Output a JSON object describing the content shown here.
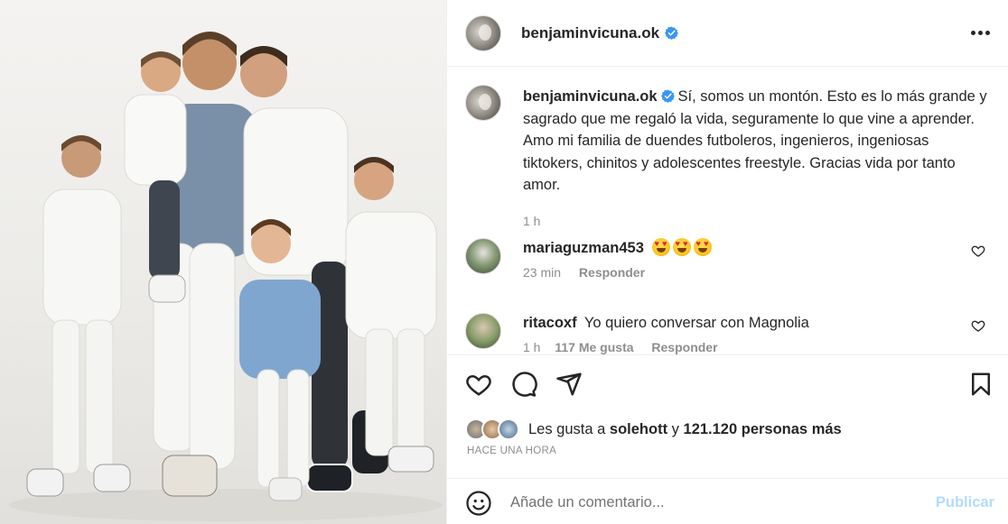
{
  "post": {
    "image_alt": "Foto familiar",
    "author": "benjaminvicuna.ok",
    "more_icon": "more-horizontal-icon"
  },
  "caption": {
    "username": "benjaminvicuna.ok",
    "text": "Sí, somos un montón. Esto es lo más grande y sagrado que me regaló la vida, seguramente lo que vine a aprender. Amo mi familia de duendes futboleros, ingenieros, ingeniosas tiktokers, chinitos y adolescentes freestyle. Gracias vida por tanto amor.",
    "time": "1 h"
  },
  "comments": [
    {
      "username": "mariaguzman453",
      "text": "",
      "emojis": [
        "heart-eyes-emoji",
        "heart-eyes-emoji",
        "heart-eyes-emoji"
      ],
      "time": "23 min",
      "reply": "Responder"
    },
    {
      "username": "ritacoxf",
      "text": "Yo quiero conversar con Magnolia",
      "time": "1 h",
      "likes": "117 Me gusta",
      "reply": "Responder"
    }
  ],
  "likes": {
    "prefix": "Les gusta a",
    "user": "solehott",
    "connector": "y",
    "count": "121.120 personas más"
  },
  "post_time": "HACE UNA HORA",
  "comment_box": {
    "placeholder": "Añade un comentario...",
    "publish": "Publicar"
  },
  "colors": {
    "verified": "#3897f0",
    "text": "#262626",
    "muted": "#8e8e8e",
    "publish_disabled": "#b3dbff",
    "border": "#efefef"
  }
}
